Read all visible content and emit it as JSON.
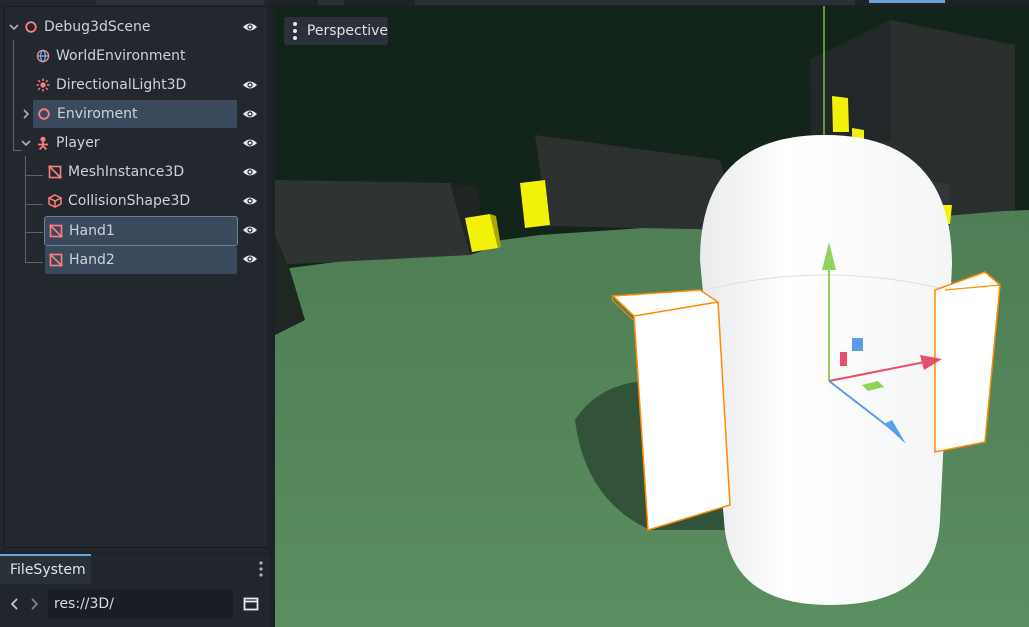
{
  "scene_tree": {
    "items": [
      {
        "label": "Debug3dScene",
        "icon": "node3d-icon",
        "visible_toggle": true,
        "expanded": true
      },
      {
        "label": "WorldEnvironment",
        "icon": "world-environment-icon",
        "visible_toggle": false
      },
      {
        "label": "DirectionalLight3D",
        "icon": "directional-light-icon",
        "visible_toggle": true
      },
      {
        "label": "Enviroment",
        "icon": "node3d-icon",
        "visible_toggle": true,
        "expanded": false,
        "selected": true
      },
      {
        "label": "Player",
        "icon": "character-body-icon",
        "visible_toggle": true,
        "expanded": true
      },
      {
        "label": "MeshInstance3D",
        "icon": "mesh-instance-icon",
        "visible_toggle": true
      },
      {
        "label": "CollisionShape3D",
        "icon": "collision-shape-icon",
        "visible_toggle": true
      },
      {
        "label": "Hand1",
        "icon": "mesh-instance-icon",
        "visible_toggle": true,
        "selected": true
      },
      {
        "label": "Hand2",
        "icon": "mesh-instance-icon",
        "visible_toggle": true,
        "selected": true
      }
    ]
  },
  "filesystem": {
    "tab_label": "FileSystem",
    "path": "res://3D/"
  },
  "viewport": {
    "view_mode_label": "Perspective"
  },
  "colors": {
    "selection": "#3a4a5c",
    "node_icon": "#fc7f7f",
    "accent": "#6aa3d8",
    "gizmo_x": "#e8506a",
    "gizmo_y": "#8fd35a",
    "gizmo_z": "#5a9de8",
    "selection_outline": "#ff8a00",
    "ground": "#5a8a5e"
  }
}
